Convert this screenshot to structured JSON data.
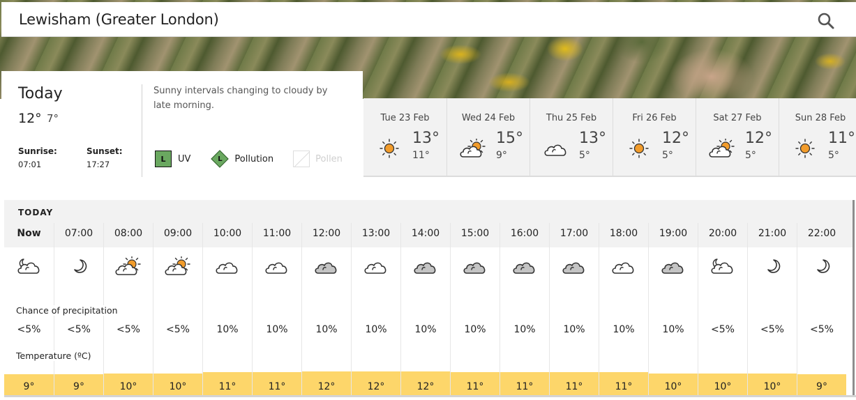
{
  "location": {
    "name": "Lewisham (Greater London)",
    "search_icon": "search-icon"
  },
  "today": {
    "title": "Today",
    "high": "12°",
    "low": "7°",
    "sunrise_label": "Sunrise:",
    "sunrise": "07:01",
    "sunset_label": "Sunset:",
    "sunset": "17:27",
    "summary": "Sunny intervals changing to cloudy by late morning.",
    "uv": {
      "level": "L",
      "label": "UV",
      "color": "#6aa860"
    },
    "pollution": {
      "level": "L",
      "label": "Pollution",
      "color": "#6aa860"
    },
    "pollen": {
      "label": "Pollen"
    }
  },
  "forecast_days": [
    {
      "label": "Tue 23 Feb",
      "icon": "sunny",
      "high": "13°",
      "low": "11°"
    },
    {
      "label": "Wed 24 Feb",
      "icon": "sunny-intervals",
      "high": "15°",
      "low": "9°"
    },
    {
      "label": "Thu 25 Feb",
      "icon": "white-cloud",
      "high": "13°",
      "low": "5°"
    },
    {
      "label": "Fri 26 Feb",
      "icon": "sunny",
      "high": "12°",
      "low": "5°"
    },
    {
      "label": "Sat 27 Feb",
      "icon": "sunny-intervals",
      "high": "12°",
      "low": "5°"
    },
    {
      "label": "Sun 28 Feb",
      "icon": "sunny",
      "high": "11°",
      "low": "5°"
    }
  ],
  "hourly": {
    "section_label": "TODAY",
    "precip_label": "Chance of precipitation",
    "temp_label": "Temperature (ºC)",
    "bar_color": "#fdd66a",
    "hours": [
      {
        "time": "Now",
        "icon": "partly-cloudy-night",
        "precip": "<5%",
        "temp": "9°",
        "temp_c": 9
      },
      {
        "time": "07:00",
        "icon": "clear-night",
        "precip": "<5%",
        "temp": "9°",
        "temp_c": 9
      },
      {
        "time": "08:00",
        "icon": "sunny-intervals",
        "precip": "<5%",
        "temp": "10°",
        "temp_c": 10
      },
      {
        "time": "09:00",
        "icon": "sunny-intervals",
        "precip": "<5%",
        "temp": "10°",
        "temp_c": 10
      },
      {
        "time": "10:00",
        "icon": "white-cloud",
        "precip": "10%",
        "temp": "11°",
        "temp_c": 11
      },
      {
        "time": "11:00",
        "icon": "white-cloud",
        "precip": "10%",
        "temp": "11°",
        "temp_c": 11
      },
      {
        "time": "12:00",
        "icon": "grey-cloud",
        "precip": "10%",
        "temp": "12°",
        "temp_c": 12
      },
      {
        "time": "13:00",
        "icon": "white-cloud",
        "precip": "10%",
        "temp": "12°",
        "temp_c": 12
      },
      {
        "time": "14:00",
        "icon": "grey-cloud",
        "precip": "10%",
        "temp": "12°",
        "temp_c": 12
      },
      {
        "time": "15:00",
        "icon": "grey-cloud",
        "precip": "10%",
        "temp": "11°",
        "temp_c": 11
      },
      {
        "time": "16:00",
        "icon": "grey-cloud",
        "precip": "10%",
        "temp": "11°",
        "temp_c": 11
      },
      {
        "time": "17:00",
        "icon": "grey-cloud",
        "precip": "10%",
        "temp": "11°",
        "temp_c": 11
      },
      {
        "time": "18:00",
        "icon": "white-cloud",
        "precip": "10%",
        "temp": "11°",
        "temp_c": 11
      },
      {
        "time": "19:00",
        "icon": "grey-cloud",
        "precip": "10%",
        "temp": "10°",
        "temp_c": 10
      },
      {
        "time": "20:00",
        "icon": "partly-cloudy-night",
        "precip": "<5%",
        "temp": "10°",
        "temp_c": 10
      },
      {
        "time": "21:00",
        "icon": "clear-night",
        "precip": "<5%",
        "temp": "10°",
        "temp_c": 10
      },
      {
        "time": "22:00",
        "icon": "clear-night",
        "precip": "<5%",
        "temp": "9°",
        "temp_c": 9
      }
    ]
  }
}
